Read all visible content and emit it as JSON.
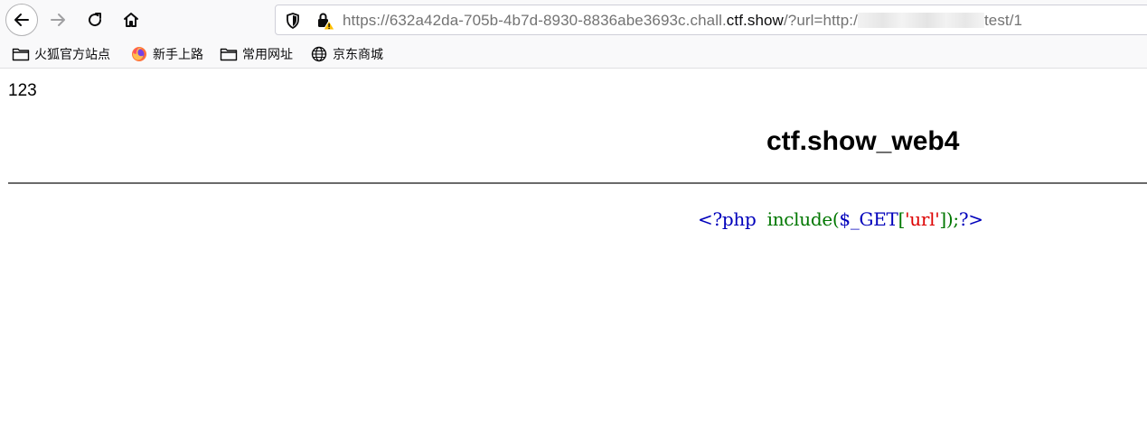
{
  "browser": {
    "url": {
      "scheme_prefix": "https://632a42da-705b-4b7d-8930-8836abe3693c.chall.",
      "host_highlight": "ctf.show",
      "path_prefix": "/?url=http:/",
      "path_suffix": "test/1"
    },
    "bookmarks": [
      {
        "label": "火狐官方站点",
        "icon": "folder-icon"
      },
      {
        "label": "新手上路",
        "icon": "firefox-icon"
      },
      {
        "label": "常用网址",
        "icon": "folder-icon"
      },
      {
        "label": "京东商城",
        "icon": "globe-icon"
      }
    ]
  },
  "page": {
    "text": "123",
    "heading": "ctf.show_web4",
    "code": {
      "open_tag": "<?php",
      "func": "include",
      "lparen": "(",
      "var": "$_GET",
      "lbracket": "[",
      "key": "'url'",
      "rbracket": "]);",
      "close_tag": "?>"
    }
  },
  "colors": {
    "php_keyword": "#0000bb",
    "php_function": "#007700",
    "php_string": "#dd0000"
  }
}
